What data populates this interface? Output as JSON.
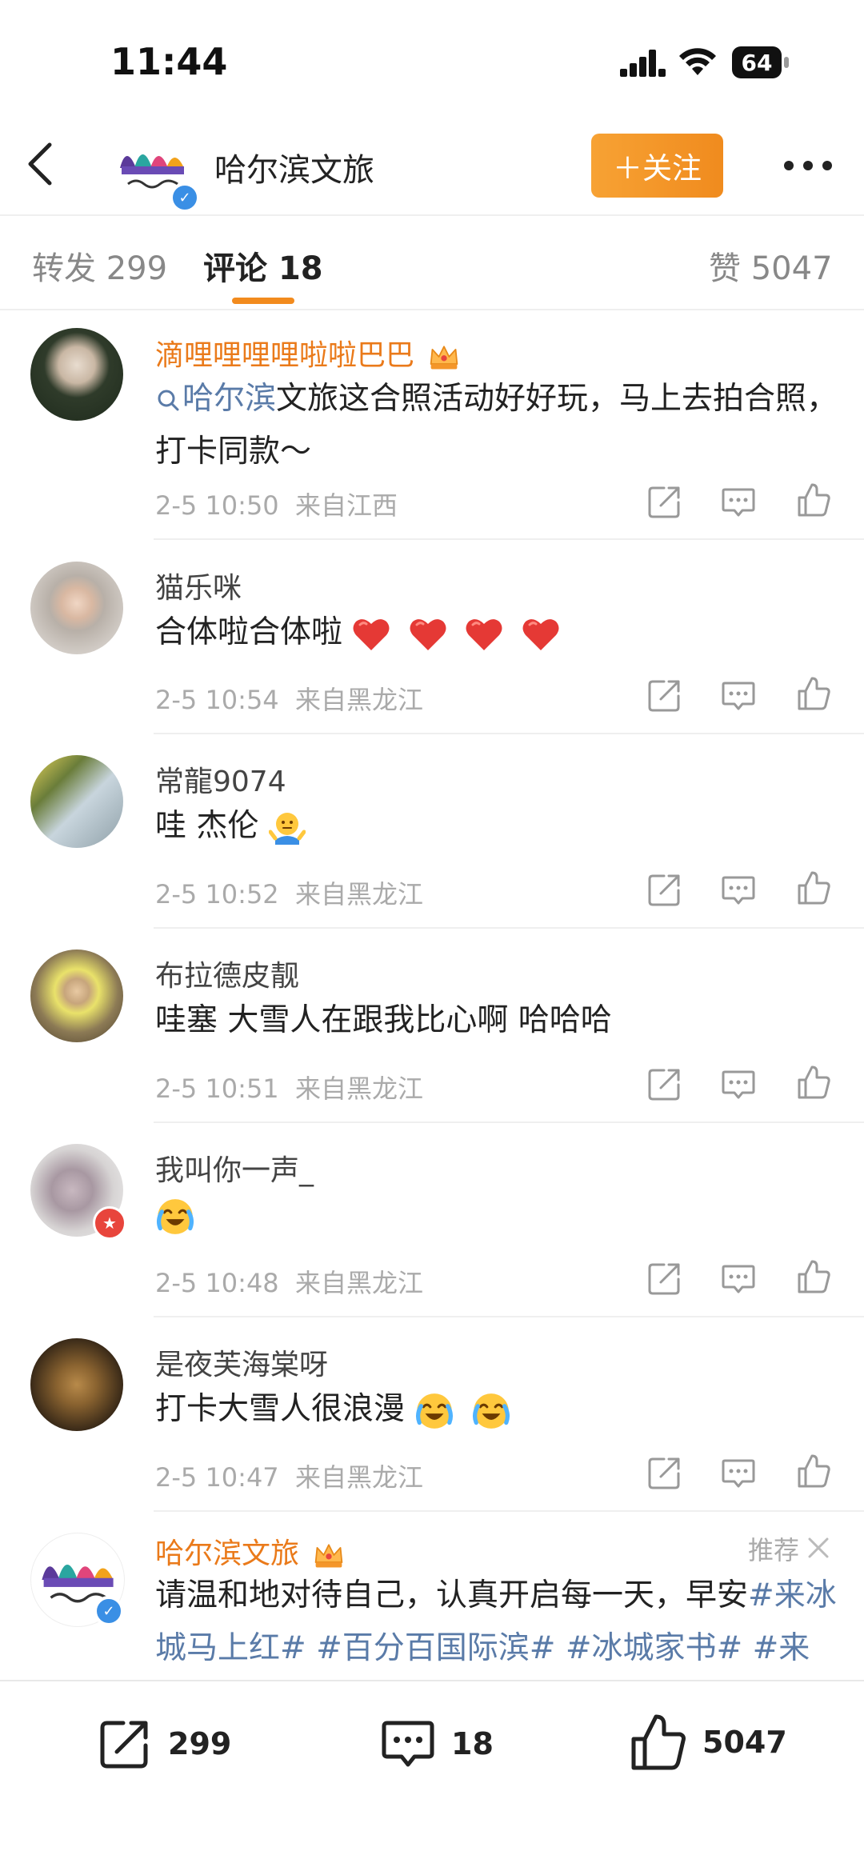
{
  "status_bar": {
    "time": "11:44",
    "battery": "64"
  },
  "header": {
    "title": "哈尔滨文旅",
    "follow_label": "＋关注"
  },
  "tabs": [
    {
      "label": "转发",
      "count": "299"
    },
    {
      "label": "评论",
      "count": "18"
    },
    {
      "label": "赞",
      "count": "5047"
    }
  ],
  "comments": [
    {
      "name": "滴哩哩哩哩啦啦巴巴",
      "text_link": "哈尔滨",
      "text": "文旅这合照活动好好玩，马上去拍合照，打卡同款～",
      "time": "2-5 10:50",
      "location": "来自江西"
    },
    {
      "name": "猫乐咪",
      "text": "合体啦合体啦",
      "time": "2-5 10:54",
      "location": "来自黑龙江"
    },
    {
      "name": "常龍9074",
      "text": "哇 杰伦",
      "time": "2-5 10:52",
      "location": "来自黑龙江"
    },
    {
      "name": "布拉德皮靓",
      "text": "哇塞 大雪人在跟我比心啊 哈哈哈",
      "time": "2-5 10:51",
      "location": "来自黑龙江"
    },
    {
      "name": "我叫你一声_",
      "text": "",
      "time": "2-5 10:48",
      "location": "来自黑龙江"
    },
    {
      "name": "是夜芙海棠呀",
      "text": "打卡大雪人很浪漫",
      "time": "2-5 10:47",
      "location": "来自黑龙江"
    },
    {
      "name": "哈尔滨文旅",
      "text": "请温和地对待自己，认真开启每一天，早安",
      "tags": "#来冰城马上红# #百分百国际滨# #冰城家书# #来"
    }
  ],
  "recommend_label": "推荐",
  "bottom_bar": {
    "repost": "299",
    "comment": "18",
    "like": "5047"
  },
  "colors": {
    "accent": "#f28b1e",
    "link": "#5a7ba8",
    "verified": "#3a8fe5"
  },
  "icons": [
    "back-icon",
    "more-icon",
    "share-icon",
    "comment-icon",
    "like-icon",
    "verified-icon",
    "crown-badge-icon",
    "heart-emoji",
    "laugh-cry-emoji",
    "shrug-emoji",
    "close-icon",
    "search-icon"
  ]
}
